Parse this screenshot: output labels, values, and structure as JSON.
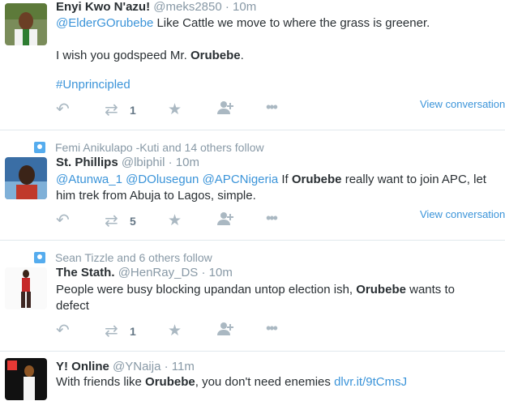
{
  "tweets": [
    {
      "name": "Enyi Kwo N'azu!",
      "handle": "@meks2850",
      "time": "10m",
      "line1_mention": "@ElderGOrubebe",
      "line1_rest": " Like Cattle we move to where the grass is greener.",
      "line2_pre": "I wish you godspeed Mr. ",
      "line2_bold": "Orubebe",
      "line2_post": ".",
      "hashtag": "#Unprincipled",
      "retweets": "1",
      "view_conversation": "View conversation"
    },
    {
      "context": "Femi Anikulapo -Kuti and 14 others follow",
      "name": "St. Phillips",
      "handle": "@lbiphil",
      "time": "10m",
      "m1": "@Atunwa_1",
      "m2": "@DOlusegun",
      "m3": "@APCNigeria",
      "t1": " If ",
      "bold": "Orubebe",
      "t2": " really want to join APC, let",
      "line2": "him trek from Abuja to Lagos, simple.",
      "retweets": "5",
      "view_conversation": "View conversation"
    },
    {
      "context": "Sean Tizzle and 6 others follow",
      "name": "The Stath.",
      "handle": "@HenRay_DS",
      "time": "10m",
      "t1": "People were busy blocking upandan untop election ish, ",
      "bold": "Orubebe",
      "t2": " wants to",
      "line2": "defect",
      "retweets": "1"
    },
    {
      "name": "Y! Online",
      "handle": "@YNaija",
      "time": "11m",
      "t1": "With friends like ",
      "bold": "Orubebe",
      "t2": ", you don't need enemies ",
      "link": "dlvr.it/9tCmsJ"
    }
  ],
  "colors": {
    "link": "#3b94d9",
    "muted": "#8899a6",
    "icon": "#aab8c2"
  },
  "icons": [
    "reply-icon",
    "retweet-icon",
    "favorite-icon",
    "follow-icon",
    "more-icon",
    "follow-context-icon"
  ]
}
